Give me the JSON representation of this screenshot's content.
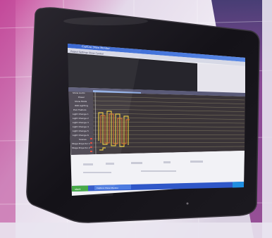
{
  "photo": {
    "subject": "wall-mounted-monitor",
    "colors": {
      "wall_light": "#e9e4ef",
      "wall_pink": "#c2478f",
      "wall_magenta": "#8a1e6a",
      "bezel": "#151318",
      "bezel_edge": "#2b2830",
      "title_bar": "#3f6fd8",
      "toolbar": "#d7d9e6",
      "app_panel": "#26252c",
      "track_bg": "#3a3438",
      "track_line": "#8f8a6a",
      "waveform_yellow": "#e0c23c",
      "waveform_orange": "#e0702c",
      "label_panel": "#4a4551",
      "lower_panel": "#f2f2f6",
      "taskbar": "#2f57c8",
      "start_button": "#3fa640"
    },
    "window": {
      "title_text": "Capture Show Monitor",
      "menu_text": "Project  Settings  Show Control"
    },
    "taskbar": {
      "start_label": "start",
      "task_label": "Capture Show Monitor"
    },
    "track_labels": [
      "Show Audio",
      "Power",
      "Show Mode",
      "WW Lighting",
      "Pool Feature",
      "Light Change 1",
      "Light Change 2",
      "Light Change 3",
      "Light Change 4",
      "Light Change 5",
      "Light Change 6",
      "Scenes",
      "Stage Projector 1",
      "Stage Projector 2"
    ]
  }
}
